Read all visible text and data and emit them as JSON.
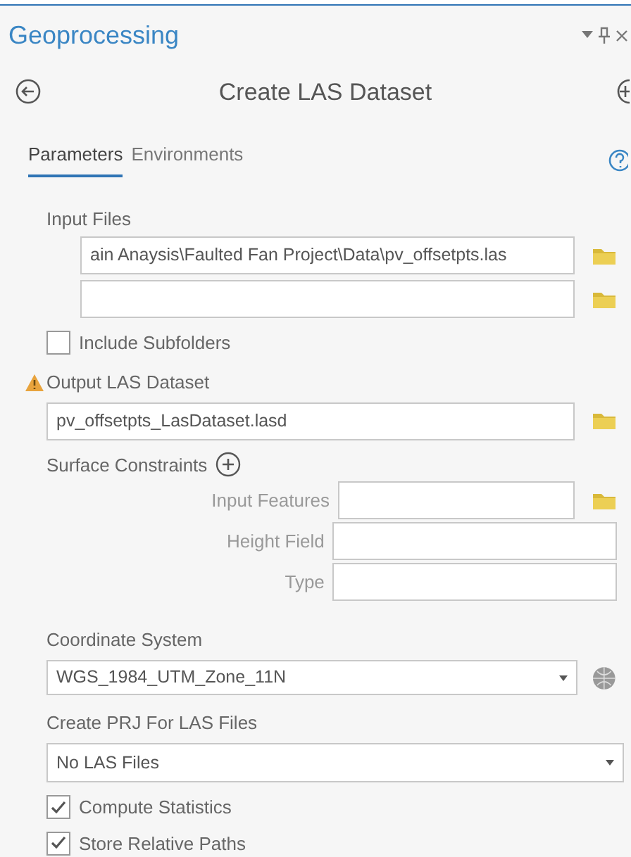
{
  "panel": {
    "title": "Geoprocessing"
  },
  "tool": {
    "title": "Create LAS Dataset"
  },
  "tabs": [
    {
      "label": "Parameters",
      "selected": true
    },
    {
      "label": "Environments",
      "selected": false
    }
  ],
  "input_files": {
    "label": "Input Files",
    "fields": [
      {
        "kind": "path",
        "value": "ain Anaysis\\Faulted Fan Project\\Data\\pv_offsetpts.las"
      },
      {
        "kind": "blank"
      }
    ]
  },
  "include_subfolders": {
    "label": "Include Subfolders",
    "checked": false
  },
  "output": {
    "label": "Output LAS Dataset",
    "warning": true,
    "value": "pv_offsetpts_LasDataset.lasd"
  },
  "surface_constraints": {
    "label": "Surface Constraints",
    "columns": [
      {
        "label": "Input Features",
        "browse": true
      },
      {
        "label": "Height Field",
        "browse": false
      },
      {
        "label": "Type",
        "browse": false
      }
    ]
  },
  "coordinate_system": {
    "label": "Coordinate System",
    "value": "WGS_1984_UTM_Zone_11N"
  },
  "create_prj": {
    "label": "Create PRJ For LAS Files",
    "value": "No LAS Files"
  },
  "options": [
    {
      "label": "Compute Statistics",
      "checked": true
    },
    {
      "label": "Store Relative Paths",
      "checked": true
    }
  ]
}
